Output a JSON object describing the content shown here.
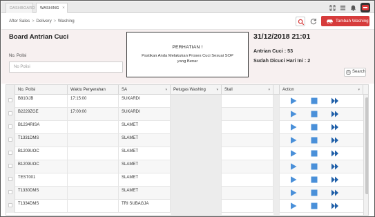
{
  "tabs": {
    "dashboard": "DASHBOARD",
    "washing": "WASHING",
    "close": "×"
  },
  "breadcrumb": {
    "items": [
      "After Sales",
      "Delivery",
      "Washing"
    ],
    "sep": ">"
  },
  "actions": {
    "add_label": "Tambah Washing",
    "search_label": "Search"
  },
  "board": {
    "title": "Board Antrian Cuci",
    "nopol_label": "No. Polisi",
    "nopol_placeholder": "No Polisi",
    "notice_title": "PERHATIAN !",
    "notice_msg": "Pastikan Anda Melakukan Proses Cuci Sesuai SOP yang Benar",
    "datetime": "31/12/2018 21:01",
    "antrian": "Antrian Cuci : 53",
    "dicuci": "Sudah Dicuci Hari Ini : 2"
  },
  "grid": {
    "columns": [
      "No. Polisi",
      "Waktu Penyerahan",
      "SA",
      "Petugas Washing",
      "Stall",
      "Action"
    ],
    "rows": [
      {
        "nopol": "B810iJB",
        "waktu": "17:15:00",
        "sa": "SUKARDI",
        "petugas": "",
        "stall": ""
      },
      {
        "nopol": "B2229ZGE",
        "waktu": "17:00:00",
        "sa": "SUKARDI",
        "petugas": "",
        "stall": ""
      },
      {
        "nopol": "B1234RISA",
        "waktu": "",
        "sa": "SLAMET",
        "petugas": "",
        "stall": ""
      },
      {
        "nopol": "T1331DMS",
        "waktu": "",
        "sa": "SLAMET",
        "petugas": "",
        "stall": ""
      },
      {
        "nopol": "B1209UOC",
        "waktu": "",
        "sa": "SLAMET",
        "petugas": "",
        "stall": ""
      },
      {
        "nopol": "B1209UOC",
        "waktu": "",
        "sa": "SLAMET",
        "petugas": "",
        "stall": ""
      },
      {
        "nopol": "TEST001",
        "waktu": "",
        "sa": "SLAMET",
        "petugas": "",
        "stall": ""
      },
      {
        "nopol": "T1330DMS",
        "waktu": "",
        "sa": "SLAMET",
        "petugas": "",
        "stall": ""
      },
      {
        "nopol": "T1334DMS",
        "waktu": "",
        "sa": "TRI SUBAGJA",
        "petugas": "",
        "stall": ""
      }
    ]
  },
  "icons": {
    "top": [
      "expand-icon",
      "list-icon",
      "bell-icon",
      "user-avatar"
    ],
    "action": [
      "play-icon",
      "stop-icon",
      "fast-forward-icon"
    ]
  },
  "colors": {
    "accent": "#d63b3b",
    "action_blue": "#4a90d9",
    "panel_bg": "#f7f0f0"
  }
}
